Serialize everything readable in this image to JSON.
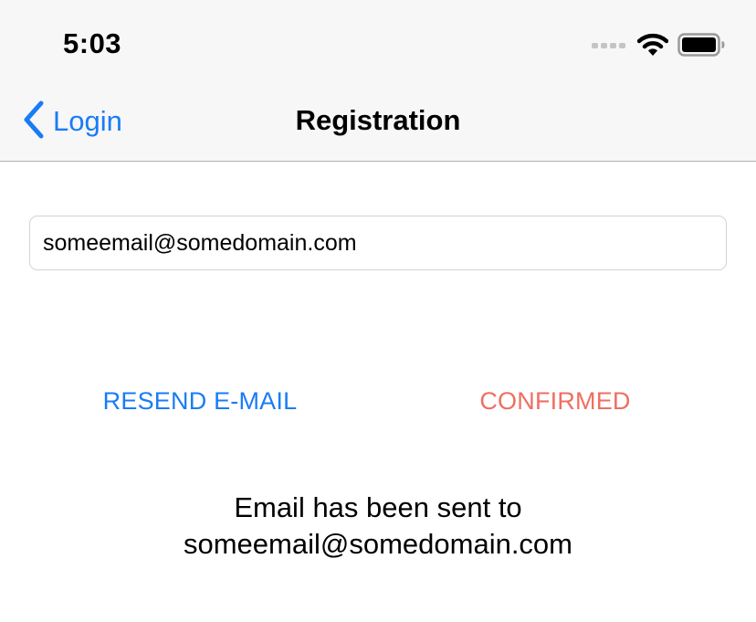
{
  "status_bar": {
    "time": "5:03",
    "icons": [
      "cellular-signal-icon",
      "wifi-icon",
      "battery-icon"
    ]
  },
  "nav_bar": {
    "back_label": "Login",
    "title": "Registration",
    "back_icon": "chevron-left-icon"
  },
  "form": {
    "email_value": "someemail@somedomain.com"
  },
  "actions": {
    "resend_label": "RESEND E-MAIL",
    "confirmed_label": "CONFIRMED"
  },
  "message": {
    "line1": "Email has been sent to",
    "line2": "someemail@somedomain.com"
  },
  "colors": {
    "accent": "#1a7cf5",
    "confirmed": "#ef6e62",
    "bar_background": "#f7f7f7"
  }
}
